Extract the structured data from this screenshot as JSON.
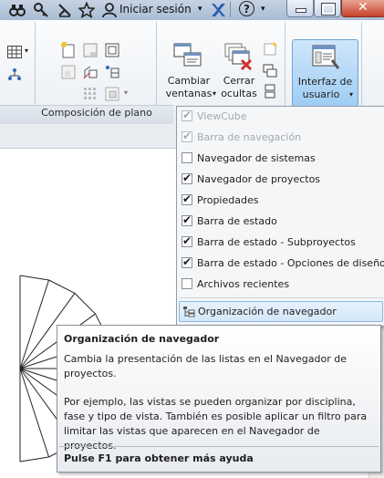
{
  "titlebar": {
    "user_label": "Iniciar sesión",
    "help_label": "?",
    "icons": [
      "binoculars-icon",
      "key-icon",
      "satellite-icon",
      "star-icon",
      "user-icon",
      "exchange-x-icon",
      "help-icon"
    ]
  },
  "ribbon": {
    "panel_title": "Composición de plano",
    "switch_windows": {
      "line1": "Cambiar",
      "line2": "ventanas"
    },
    "close_hidden": {
      "line1": "Cerrar",
      "line2": "ocultas"
    },
    "user_interface": {
      "line1": "Interfaz de",
      "line2": "usuario"
    }
  },
  "menu": {
    "items": [
      {
        "label": "ViewCube",
        "checked": true,
        "enabled": false
      },
      {
        "label": "Barra de navegación",
        "checked": true,
        "enabled": false
      },
      {
        "label": "Navegador de sistemas",
        "checked": false,
        "enabled": true
      },
      {
        "label": "Navegador de proyectos",
        "checked": true,
        "enabled": true
      },
      {
        "label": "Propiedades",
        "checked": true,
        "enabled": true
      },
      {
        "label": "Barra de estado",
        "checked": true,
        "enabled": true
      },
      {
        "label": "Barra de estado - Subproyectos",
        "checked": true,
        "enabled": true
      },
      {
        "label": "Barra de estado - Opciones de diseño",
        "checked": true,
        "enabled": true
      },
      {
        "label": "Archivos recientes",
        "checked": false,
        "enabled": true
      }
    ],
    "highlighted_item": "Organización de navegador"
  },
  "tooltip": {
    "title": "Organización de navegador",
    "para1": "Cambia la presentación de las listas en el Navegador de proyectos.",
    "para2": "Por ejemplo, las vistas se pueden organizar por disciplina, fase y tipo de vista. También es posible aplicar un filtro para limitar las vistas que aparecen en el Navegador de proyectos.",
    "help": "Pulse F1 para obtener más ayuda"
  },
  "colors": {
    "accent": "#9fcdf3",
    "check": "#1a1a1a",
    "red_x": "#d42a2a"
  }
}
